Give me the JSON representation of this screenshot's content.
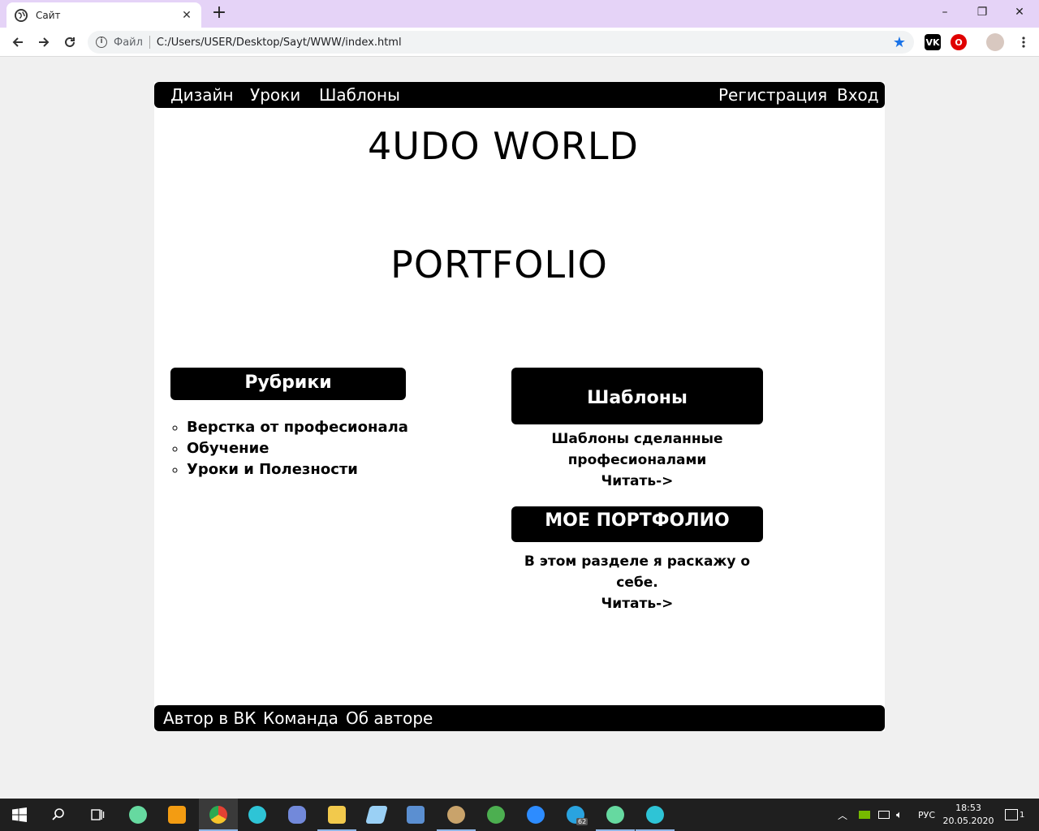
{
  "browser": {
    "tab_title": "Сайт",
    "tab_close": "✕",
    "new_tab": "+",
    "window_controls": {
      "minimize": "–",
      "restore": "❐",
      "close": "✕"
    },
    "scheme_label": "Файл",
    "url": "C:/Users/USER/Desktop/Sayt/WWW/index.html",
    "star": "★",
    "extensions": [
      {
        "name": "vk-extension",
        "label": "VK",
        "color": "#000000"
      },
      {
        "name": "opera-extension",
        "label": "O",
        "color": "#e00000"
      }
    ]
  },
  "site": {
    "nav_left": [
      "Дизайн",
      "Уроки",
      "Шаблоны"
    ],
    "nav_right": [
      "Регистрация",
      "Вход"
    ],
    "title": "4UDO WORLD",
    "hero": "PORTFOLIO",
    "rubrics": {
      "heading": "Рубрики",
      "items": [
        "Верстка от професионала",
        "Обучение",
        "Уроки и Полезности"
      ]
    },
    "cards": [
      {
        "heading": "Шаблоны",
        "text_line1": "Шаблоны сделанные",
        "text_line2": "професионалами",
        "link": "Читать->"
      },
      {
        "heading": "МОЕ ПОРТФОЛИО",
        "text_line1": "В этом разделе я раскажу о",
        "text_line2": "себе.",
        "link": "Читать->"
      }
    ],
    "footer": [
      "Автор в ВК",
      "Команда",
      "Об авторе"
    ]
  },
  "taskbar": {
    "tray_lang": "РУС",
    "time": "18:53",
    "date": "20.05.2020",
    "notification_count": "1",
    "telegram_badge": "62",
    "apps": [
      {
        "name": "start-icon",
        "color": "#ffffff"
      },
      {
        "name": "search-icon",
        "color": "#ffffff"
      },
      {
        "name": "task-view-icon",
        "color": "#ffffff"
      },
      {
        "name": "atom-icon",
        "color": "#66d9a0"
      },
      {
        "name": "sublime-icon",
        "color": "#f39c12"
      },
      {
        "name": "chrome-icon",
        "color": "#e34133"
      },
      {
        "name": "messenger-icon",
        "color": "#2ec4d6"
      },
      {
        "name": "discord-icon",
        "color": "#7289da"
      },
      {
        "name": "file-explorer-icon",
        "color": "#f2c94c"
      },
      {
        "name": "notes-icon",
        "color": "#9ad0f5"
      },
      {
        "name": "vscode-like-icon",
        "color": "#5b8fd1"
      },
      {
        "name": "paint-icon",
        "color": "#c9a36b"
      },
      {
        "name": "utorrent-icon",
        "color": "#4caf50"
      },
      {
        "name": "zoom-icon",
        "color": "#2d8cff"
      },
      {
        "name": "telegram-icon",
        "color": "#2aa3df"
      },
      {
        "name": "atom2-icon",
        "color": "#66d9a0"
      },
      {
        "name": "messenger2-icon",
        "color": "#2ec4d6"
      }
    ]
  }
}
